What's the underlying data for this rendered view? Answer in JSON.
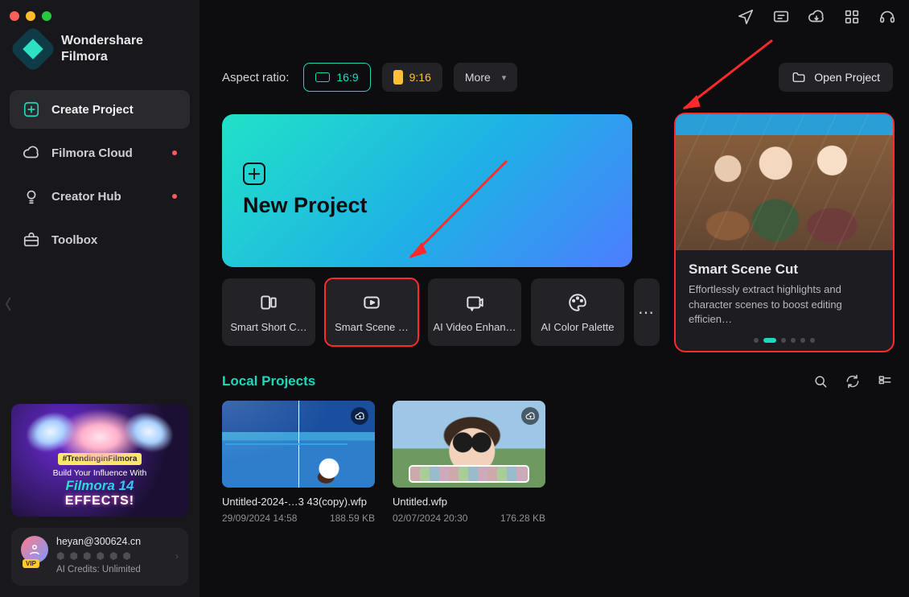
{
  "brand": {
    "line1": "Wondershare",
    "line2": "Filmora"
  },
  "sidebar": {
    "items": [
      {
        "label": "Create Project",
        "dot": false,
        "active": true
      },
      {
        "label": "Filmora Cloud",
        "dot": true,
        "active": false
      },
      {
        "label": "Creator Hub",
        "dot": true,
        "active": false
      },
      {
        "label": "Toolbox",
        "dot": false,
        "active": false
      }
    ]
  },
  "promo": {
    "tag": "#TrendinginFilmora",
    "line1": "Build Your Influence With",
    "line2": "Filmora 14",
    "line3": "EFFECTS!"
  },
  "user": {
    "email": "heyan@300624.cn",
    "vip": "VIP",
    "credits_label": "AI Credits: Unlimited"
  },
  "ratio": {
    "label": "Aspect ratio:",
    "r169": "16:9",
    "r916": "9:16",
    "more": "More"
  },
  "open_project": "Open Project",
  "new_project": {
    "title": "New Project"
  },
  "tools": [
    {
      "label": "Smart Short C…"
    },
    {
      "label": "Smart Scene …"
    },
    {
      "label": "AI Video Enhan…"
    },
    {
      "label": "AI Color Palette"
    }
  ],
  "feature": {
    "title": "Smart Scene Cut",
    "desc": "Effortlessly extract highlights and character scenes to boost editing efficien…",
    "active_dot_index": 1,
    "dot_count": 6
  },
  "local": {
    "title": "Local Projects",
    "projects": [
      {
        "name": "Untitled-2024-…3 43(copy).wfp",
        "date": "29/09/2024 14:58",
        "size": "188.59 KB"
      },
      {
        "name": "Untitled.wfp",
        "date": "02/07/2024 20:30",
        "size": "176.28 KB"
      }
    ]
  }
}
